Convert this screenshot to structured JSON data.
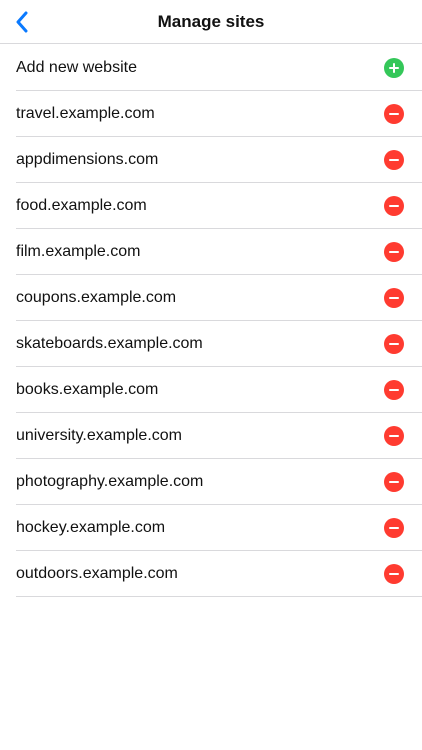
{
  "header": {
    "title": "Manage sites",
    "back_icon": "chevron-left-icon"
  },
  "colors": {
    "accent": "#0a7aff",
    "add": "#34c759",
    "remove": "#ff3b30",
    "separator": "#d9d9dc"
  },
  "add_row": {
    "label": "Add new website",
    "icon": "plus-circle-icon"
  },
  "sites": [
    {
      "label": "travel.example.com",
      "icon": "minus-circle-icon"
    },
    {
      "label": "appdimensions.com",
      "icon": "minus-circle-icon"
    },
    {
      "label": "food.example.com",
      "icon": "minus-circle-icon"
    },
    {
      "label": "film.example.com",
      "icon": "minus-circle-icon"
    },
    {
      "label": "coupons.example.com",
      "icon": "minus-circle-icon"
    },
    {
      "label": "skateboards.example.com",
      "icon": "minus-circle-icon"
    },
    {
      "label": "books.example.com",
      "icon": "minus-circle-icon"
    },
    {
      "label": "university.example.com",
      "icon": "minus-circle-icon"
    },
    {
      "label": "photography.example.com",
      "icon": "minus-circle-icon"
    },
    {
      "label": "hockey.example.com",
      "icon": "minus-circle-icon"
    },
    {
      "label": "outdoors.example.com",
      "icon": "minus-circle-icon"
    }
  ]
}
